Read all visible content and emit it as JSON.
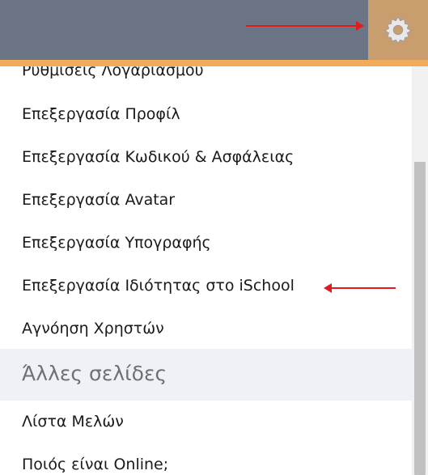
{
  "header": {
    "settings_icon": "gear-icon",
    "colors": {
      "bar": "#6b7585",
      "settings_button": "#c89e6e",
      "accent_line": "#f0ac5a",
      "arrow": "#e11b1b"
    }
  },
  "menu": {
    "items_top": [
      "Ρυθμίσεις Λογαριασμού",
      "Επεξεργασία Προφίλ",
      "Επεξεργασία Κωδικού & Ασφάλειας",
      "Επεξεργασία Avatar",
      "Επεξεργασία Υπογραφής",
      "Επεξεργασία Ιδιότητας στο iSchool",
      "Αγνόηση Χρηστών"
    ],
    "section_title": "Άλλες σελίδες",
    "items_bottom": [
      "Λίστα Μελών",
      "Ποιός είναι Online;"
    ]
  }
}
